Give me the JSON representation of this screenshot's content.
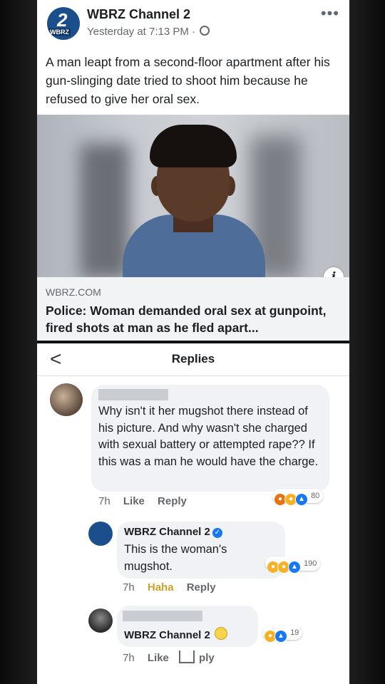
{
  "post": {
    "page_name": "WBRZ Channel 2",
    "avatar_number": "2",
    "avatar_tag": "WBRZ",
    "time": "Yesterday at 7:13 PM ·",
    "more": "•••",
    "text": "A man leapt from a second-floor apartment after his gun-slinging date tried to shoot him because he refused to give her oral sex.",
    "info_icon": "i",
    "link": {
      "domain": "WBRZ.COM",
      "title": "Police: Woman demanded oral sex at gunpoint, fired shots at man as he fled apart..."
    }
  },
  "replies": {
    "back": "<",
    "title": "Replies",
    "comments": [
      {
        "text": "Why isn't it her mugshot there instead of his picture. And why wasn't she charged with sexual battery or attempted rape?? If this was a man he would have the charge.",
        "age": "7h",
        "like": "Like",
        "reply": "Reply",
        "reactions": [
          "angry",
          "wow",
          "like"
        ],
        "reaction_count": "80"
      },
      {
        "author": "WBRZ Channel 2",
        "verified": "✓",
        "text": "This is the woman's mugshot.",
        "age": "7h",
        "like": "Haha",
        "reply": "Reply",
        "reactions": [
          "haha",
          "wow",
          "like"
        ],
        "reaction_count": "190"
      },
      {
        "author": "WBRZ Channel 2",
        "age": "7h",
        "like": "Like",
        "reply": "ply",
        "reactions": [
          "haha",
          "like"
        ],
        "reaction_count": "19"
      }
    ]
  },
  "colors": {
    "brand": "#1b4f8c",
    "facebook_blue": "#1877f2",
    "bubble": "#f0f2f5",
    "muted": "#65676b"
  }
}
